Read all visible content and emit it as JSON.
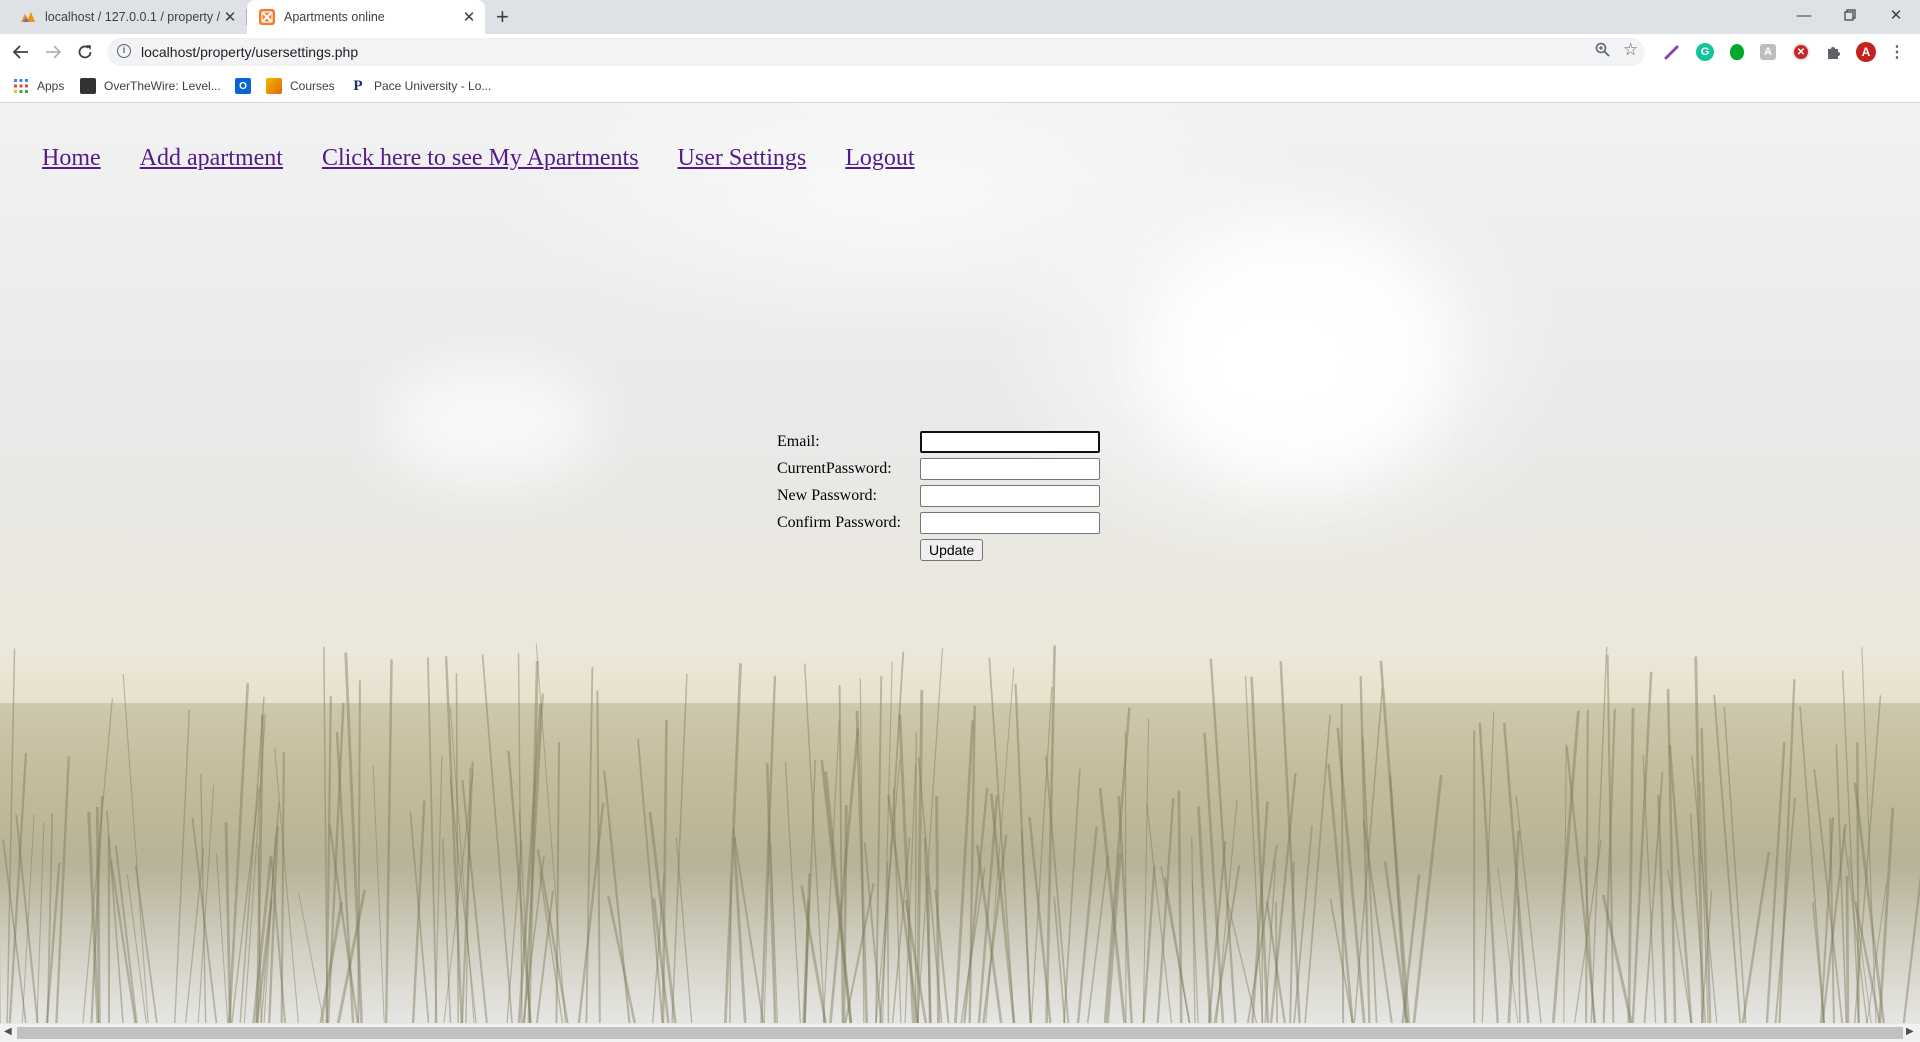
{
  "browser": {
    "tabs": [
      {
        "title": "localhost / 127.0.0.1 / property /",
        "favicon": "phpmyadmin-icon",
        "active": false
      },
      {
        "title": "Apartments online",
        "favicon": "xampp-icon",
        "active": true
      }
    ],
    "new_tab_label": "+",
    "url": "localhost/property/usersettings.php",
    "profile_initial": "A",
    "bookmarks": [
      {
        "label": "Apps",
        "icon": "apps-grid-icon"
      },
      {
        "label": "OverTheWire: Level...",
        "icon": "overthewire-icon"
      },
      {
        "label": "",
        "icon": "outlook-icon"
      },
      {
        "label": "Courses",
        "icon": "courses-icon"
      },
      {
        "label": "Pace University - Lo...",
        "icon": "pace-icon"
      }
    ]
  },
  "page": {
    "nav": [
      {
        "label": "Home"
      },
      {
        "label": "Add apartment"
      },
      {
        "label": "Click here to see My Apartments"
      },
      {
        "label": "User Settings"
      },
      {
        "label": "Logout"
      }
    ],
    "form": {
      "email_label": "Email:",
      "email_value": "",
      "current_password_label": "CurrentPassword:",
      "current_password_value": "",
      "new_password_label": "New Password:",
      "new_password_value": "",
      "confirm_password_label": "Confirm Password:",
      "confirm_password_value": "",
      "submit_label": "Update"
    }
  },
  "colors": {
    "link_visited": "#551a8b",
    "chrome_frame": "#dee1e6",
    "grammarly": "#15c39a",
    "evernote": "#00a82d",
    "profile": "#c5221f"
  }
}
